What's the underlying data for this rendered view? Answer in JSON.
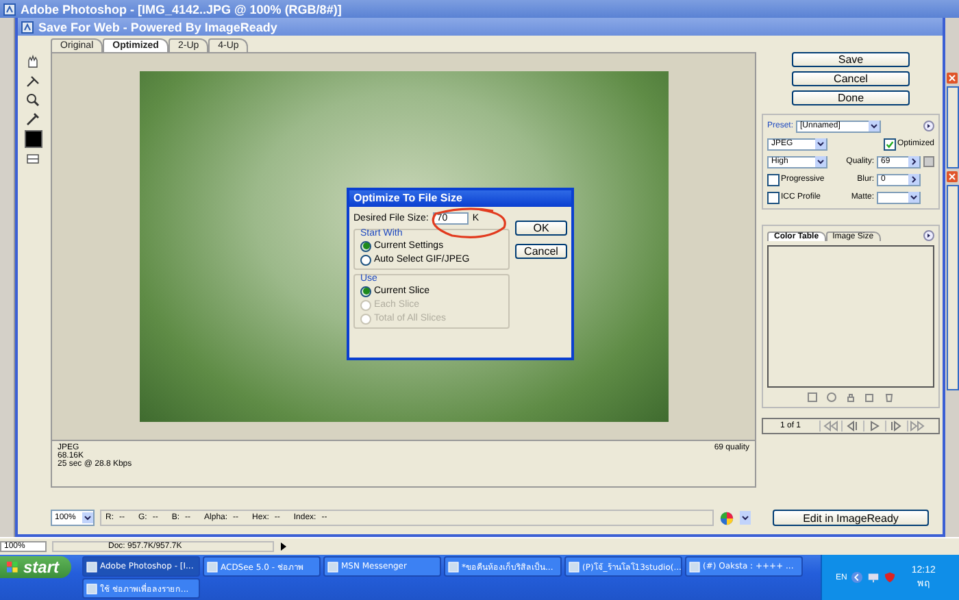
{
  "photoshop": {
    "title": "Adobe Photoshop - [IMG_4142..JPG @ 100% (RGB/8#)]",
    "zoom": "100%",
    "doc": "Doc: 957.7K/957.7K"
  },
  "save_for_web": {
    "title": "Save For Web - Powered By ImageReady",
    "tabs": [
      {
        "label": "Original",
        "selected": false
      },
      {
        "label": "Optimized",
        "selected": true
      },
      {
        "label": "2-Up",
        "selected": false
      },
      {
        "label": "4-Up",
        "selected": false
      }
    ],
    "info": {
      "lines": [
        "JPEG",
        "68.16K",
        "25 sec @ 28.8 Kbps"
      ],
      "quality": "69 quality"
    },
    "zoom": "100%",
    "readouts": [
      {
        "label": "R:",
        "value": "--"
      },
      {
        "label": "G:",
        "value": "--"
      },
      {
        "label": "B:",
        "value": "--"
      },
      {
        "label": "Alpha:",
        "value": "--"
      },
      {
        "label": "Hex:",
        "value": "--"
      },
      {
        "label": "Index:",
        "value": "--"
      }
    ],
    "buttons": [
      "Save",
      "Cancel",
      "Done"
    ],
    "settings": {
      "preset_label": "Preset:",
      "preset": "[Unnamed]",
      "format": "JPEG",
      "compression": "High",
      "quality_label": "Quality:",
      "quality": "69",
      "blur_label": "Blur:",
      "blur": "0",
      "matte_label": "Matte:",
      "checks": [
        {
          "label": "Optimized",
          "checked": true
        },
        {
          "label": "Progressive",
          "checked": false
        },
        {
          "label": "ICC Profile",
          "checked": false
        }
      ]
    },
    "panel_tabs": [
      {
        "label": "Color Table",
        "selected": true
      },
      {
        "label": "Image Size",
        "selected": false
      }
    ],
    "pager": "1 of 1",
    "edit_button": "Edit in ImageReady"
  },
  "dialog": {
    "title": "Optimize To File Size",
    "size_label": "Desired File Size:",
    "size": "70",
    "unit": "K",
    "buttons": [
      "OK",
      "Cancel"
    ],
    "groups": [
      {
        "title": "Start With",
        "options": [
          {
            "label": "Current Settings",
            "selected": true,
            "disabled": false
          },
          {
            "label": "Auto Select GIF/JPEG",
            "selected": false,
            "disabled": false
          }
        ]
      },
      {
        "title": "Use",
        "options": [
          {
            "label": "Current Slice",
            "selected": true,
            "disabled": false
          },
          {
            "label": "Each Slice",
            "selected": false,
            "disabled": true
          },
          {
            "label": "Total of All Slices",
            "selected": false,
            "disabled": true
          }
        ]
      }
    ]
  },
  "taskbar": {
    "start": "start",
    "rows": [
      [
        {
          "label": "Adobe Photoshop - [I...",
          "selected": true
        },
        {
          "label": "ACDSee 5.0 - ช่อภาพ",
          "selected": false
        },
        {
          "label": "MSN Messenger",
          "selected": false
        },
        {
          "label": "*ขอคืนห้องเก็บริสิลเป็น...",
          "selected": false
        },
        {
          "label": "(P)โจ้_ร้านโลโ13studio(...",
          "selected": false
        },
        {
          "label": "(#) Oaksta : ++++ ...",
          "selected": false
        }
      ],
      [
        {
          "label": "ใช้ ช่อภาพเพื่อลงรายก...",
          "selected": false
        }
      ]
    ],
    "language": "EN",
    "clock": "12:12",
    "day": "พฤ"
  }
}
